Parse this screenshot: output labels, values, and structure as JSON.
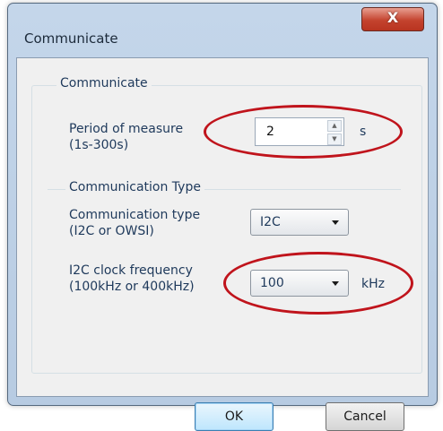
{
  "window": {
    "title": "Communicate",
    "close_glyph": "X"
  },
  "group": {
    "label": "Communicate",
    "period": {
      "label_line1": "Period of measure",
      "label_line2": "(1s-300s)",
      "value": "2",
      "unit": "s"
    }
  },
  "comm_group": {
    "label": "Communication Type",
    "type": {
      "label_line1": "Communication type",
      "label_line2": "(I2C or OWSI)",
      "value": "I2C"
    },
    "clock": {
      "label_line1": "I2C clock frequency",
      "label_line2": "(100kHz or 400kHz)",
      "value": "100",
      "unit": "kHz"
    }
  },
  "buttons": {
    "ok": "OK",
    "cancel": "Cancel"
  },
  "highlight_color": "#c0141c"
}
